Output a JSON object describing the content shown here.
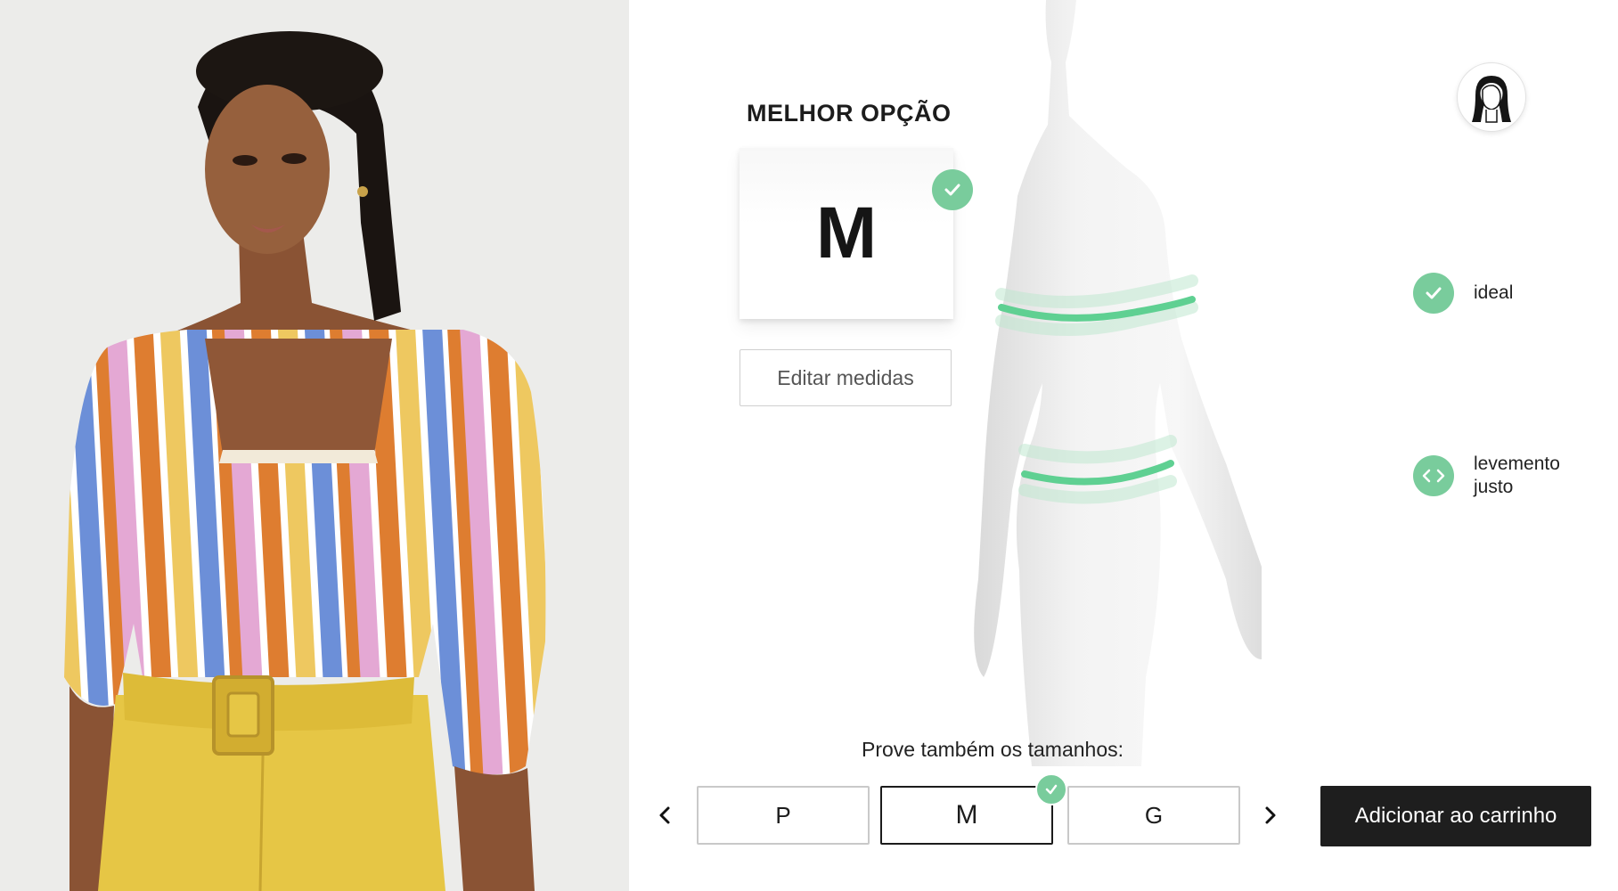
{
  "best_option": {
    "title": "MELHOR OPÇÃO",
    "size": "M",
    "edit_label": "Editar medidas"
  },
  "fit_legend": [
    {
      "icon": "check-icon",
      "label": "ideal"
    },
    {
      "icon": "expand-horizontal-icon",
      "label": "levemento justo"
    }
  ],
  "try_sizes": {
    "label": "Prove também os tamanhos:",
    "options": [
      "P",
      "M",
      "G"
    ],
    "selected": "M"
  },
  "add_to_cart_label": "Adicionar ao carrinho",
  "colors": {
    "accent_green": "#79cc9c",
    "button_dark": "#1e1e1e"
  },
  "icons": {
    "avatar": "female-avatar-icon",
    "prev": "chevron-left-icon",
    "next": "chevron-right-icon"
  }
}
